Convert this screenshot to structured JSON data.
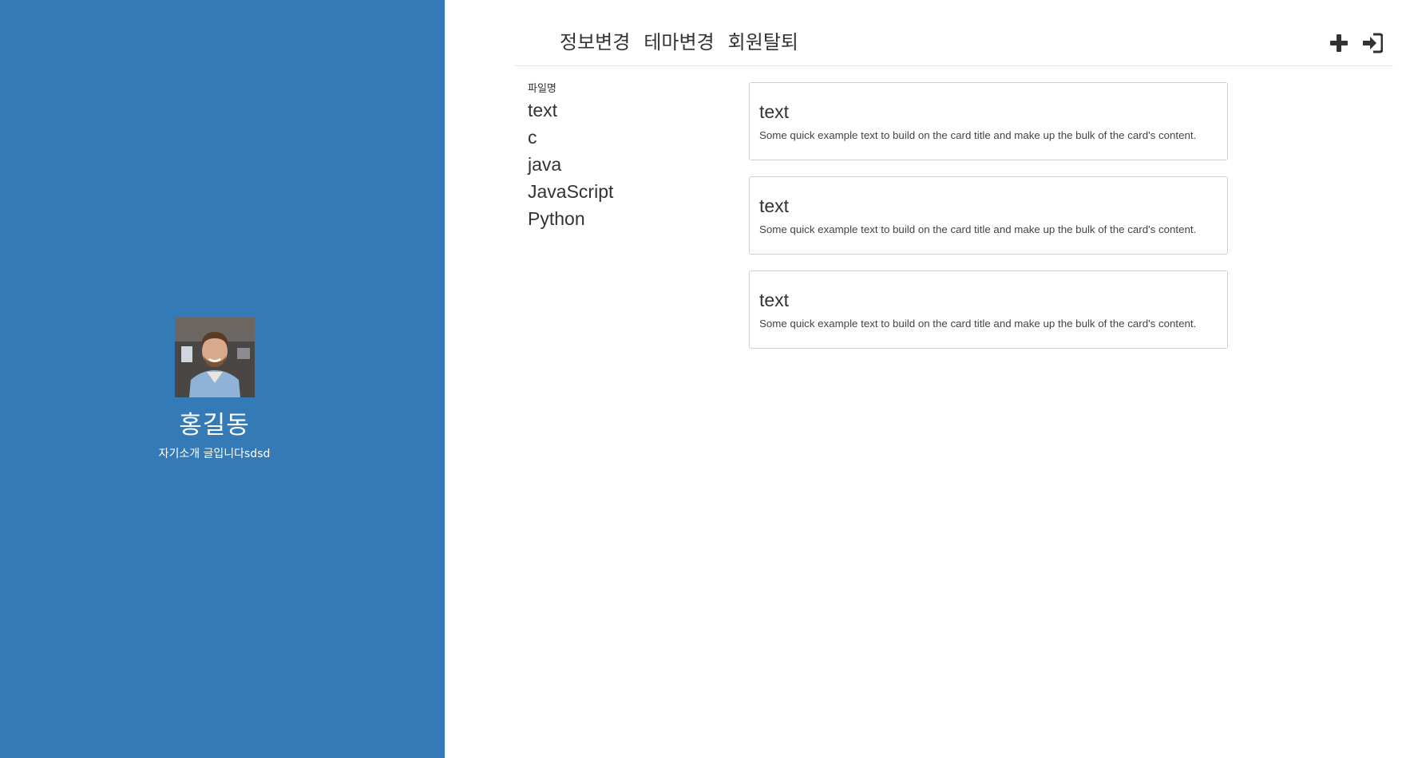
{
  "profile": {
    "name": "홍길동",
    "intro": "자기소개 글입니다sdsd"
  },
  "nav": {
    "menu": [
      {
        "label": "정보변경"
      },
      {
        "label": "테마변경"
      },
      {
        "label": "회원탈퇴"
      }
    ],
    "actions": {
      "add_icon": "plus-icon",
      "login_icon": "sign-in-icon"
    }
  },
  "files": {
    "label": "파일명",
    "items": [
      "text",
      "c",
      "java",
      "JavaScript",
      "Python"
    ]
  },
  "cards": [
    {
      "title": "text",
      "text": "Some quick example text to build on the card title and make up the bulk of the card's content."
    },
    {
      "title": "text",
      "text": "Some quick example text to build on the card title and make up the bulk of the card's content."
    },
    {
      "title": "text",
      "text": "Some quick example text to build on the card title and make up the bulk of the card's content."
    }
  ],
  "colors": {
    "sidebar": "#337ab7",
    "text": "#333333",
    "card_border": "#cfcfcf"
  }
}
